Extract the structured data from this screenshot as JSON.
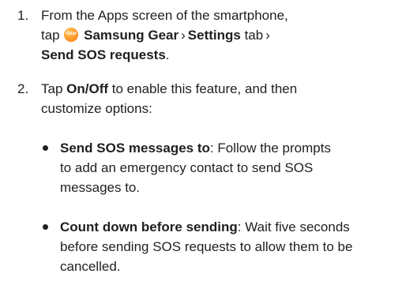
{
  "steps": [
    {
      "number": "1.",
      "line1": "From the Apps screen of the smartphone,",
      "line2_pre": "tap",
      "gear_icon_label": "Gear",
      "app_name": "Samsung Gear",
      "separator": "›",
      "tab_name": "Settings",
      "tab_suffix": "tab",
      "setting_name": "Send SOS requests",
      "period": "."
    },
    {
      "number": "2.",
      "pre": "Tap",
      "toggle_name": "On/Off",
      "line1_post": "to enable this feature, and then",
      "line2": "customize options:"
    }
  ],
  "bullets": [
    {
      "term": "Send SOS messages to",
      "line1_post": ": Follow the prompts",
      "line2": "to add an emergency contact to send SOS",
      "line3": "messages to."
    },
    {
      "term": "Count down before sending",
      "line1_post": ": Wait five seconds",
      "line2": "before sending SOS requests to allow them to be",
      "line3": "cancelled."
    }
  ],
  "colors": {
    "text": "#1f1f1f",
    "gear_icon": "#ff9a2a"
  }
}
